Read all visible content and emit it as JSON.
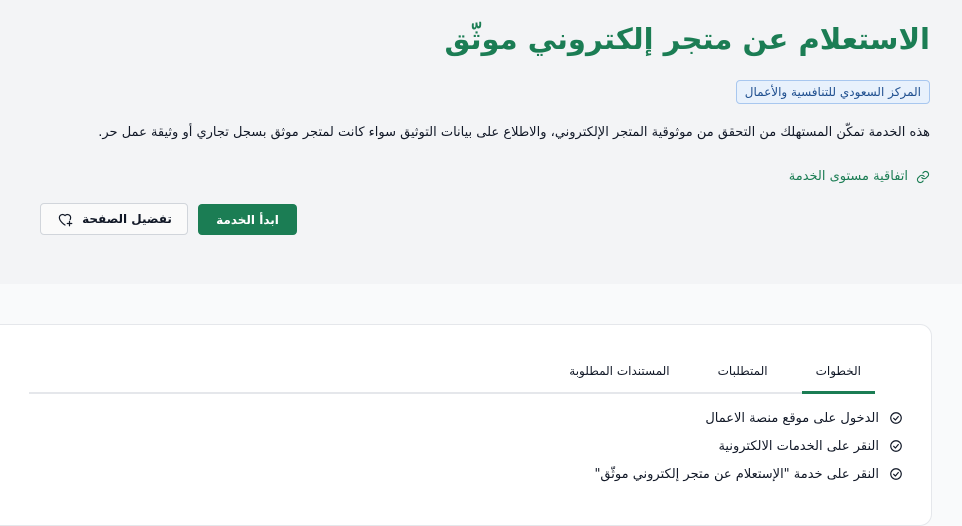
{
  "service": {
    "title": "الاستعلام عن متجر إلكتروني موثّق",
    "provider": "المركز السعودي للتنافسية والأعمال",
    "description": "هذه الخدمة تمكّن المستهلك من التحقق من موثوقية المتجر الإلكتروني، والاطلاع على بيانات التوثيق سواء كانت لمتجر موثق بسجل تجاري أو وثيقة عمل حر.",
    "sla_link": "اتفاقية مستوى الخدمة"
  },
  "actions": {
    "favorite_label": "تفضيل الصفحة",
    "start_label": "ابدأ الخدمة"
  },
  "tabs": [
    {
      "label": "الخطوات",
      "active": true
    },
    {
      "label": "المتطلبات",
      "active": false
    },
    {
      "label": "المستندات المطلوبة",
      "active": false
    }
  ],
  "steps": [
    "الدخول على موقع منصة الاعمال",
    "النقر على الخدمات الالكترونية",
    "النقر على خدمة \"الإستعلام عن متجر إلكتروني موثّق\""
  ],
  "colors": {
    "brand_green": "#1b7d54",
    "badge_bg": "#e8f1fc",
    "badge_border": "#a8c7ef"
  },
  "icons": {
    "link": "link-icon",
    "favorite": "heart-plus-icon",
    "step": "check-circle-icon"
  }
}
